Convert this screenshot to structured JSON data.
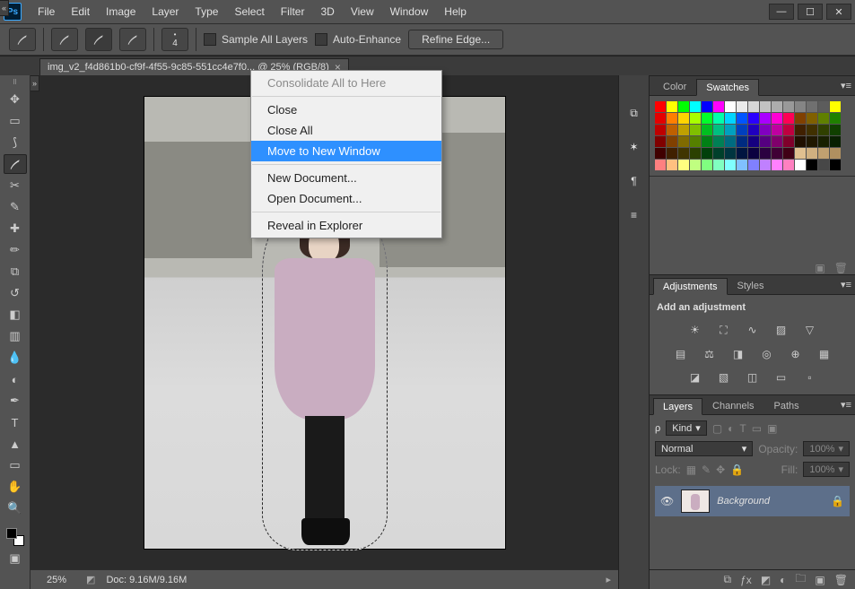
{
  "menubar": {
    "file": "File",
    "edit": "Edit",
    "image": "Image",
    "layer": "Layer",
    "type": "Type",
    "select": "Select",
    "filter": "Filter",
    "threeD": "3D",
    "view": "View",
    "window": "Window",
    "help": "Help"
  },
  "options": {
    "brush_size": "4",
    "sample_all": "Sample All Layers",
    "auto_enhance": "Auto-Enhance",
    "refine": "Refine Edge..."
  },
  "doc_tab": {
    "label": "img_v2_f4d861b0-cf9f-4f55-9c85-551cc4e7f0... @ 25% (RGB/8)"
  },
  "context_menu": {
    "consolidate": "Consolidate All to Here",
    "close": "Close",
    "close_all": "Close All",
    "move_new_window": "Move to New Window",
    "new_doc": "New Document...",
    "open_doc": "Open Document...",
    "reveal": "Reveal in Explorer"
  },
  "status": {
    "zoom": "25%",
    "doc": "Doc: 9.16M/9.16M"
  },
  "panels": {
    "color_tab": "Color",
    "swatches_tab": "Swatches",
    "adjustments_tab": "Adjustments",
    "styles_tab": "Styles",
    "add_adjustment": "Add an adjustment",
    "layers_tab": "Layers",
    "channels_tab": "Channels",
    "paths_tab": "Paths",
    "kind": "Kind",
    "blend": "Normal",
    "opacity_lbl": "Opacity:",
    "opacity_val": "100%",
    "lock_lbl": "Lock:",
    "fill_lbl": "Fill:",
    "fill_val": "100%",
    "layer_name": "Background"
  },
  "swatch_colors": [
    "#ff0000",
    "#ffff00",
    "#00ff00",
    "#00ffff",
    "#0000ff",
    "#ff00ff",
    "#ffffff",
    "#ebebeb",
    "#d6d6d6",
    "#c2c2c2",
    "#adadad",
    "#999999",
    "#858585",
    "#707070",
    "#5c5c5c",
    "#ffff00",
    "#e40000",
    "#ff7f00",
    "#ffd400",
    "#a9ff00",
    "#00ff2a",
    "#00ffaa",
    "#00d4ff",
    "#0055ff",
    "#2a00ff",
    "#aa00ff",
    "#ff00d4",
    "#ff0055",
    "#804000",
    "#806000",
    "#608000",
    "#208000",
    "#bf0000",
    "#bf6000",
    "#bfa000",
    "#80bf00",
    "#00bf20",
    "#00bf80",
    "#00a0bf",
    "#0040bf",
    "#2000bf",
    "#8000bf",
    "#bf00a0",
    "#bf0040",
    "#402000",
    "#403000",
    "#304000",
    "#104000",
    "#800000",
    "#804000",
    "#806b00",
    "#558000",
    "#008015",
    "#008055",
    "#006b80",
    "#002b80",
    "#150080",
    "#550080",
    "#80006b",
    "#80002b",
    "#201000",
    "#201800",
    "#182000",
    "#082000",
    "#400000",
    "#402000",
    "#403500",
    "#2b4000",
    "#00400b",
    "#00402b",
    "#003540",
    "#001540",
    "#0b0040",
    "#2b0040",
    "#400035",
    "#400015",
    "#e0c090",
    "#d0b080",
    "#c0a070",
    "#b09060",
    "#ff8080",
    "#ffc080",
    "#ffff80",
    "#c0ff80",
    "#80ff80",
    "#80ffc0",
    "#80ffff",
    "#80c0ff",
    "#8080ff",
    "#c080ff",
    "#ff80ff",
    "#ff80c0",
    "#ffffff",
    "#000000",
    "#474747",
    "#000000"
  ]
}
